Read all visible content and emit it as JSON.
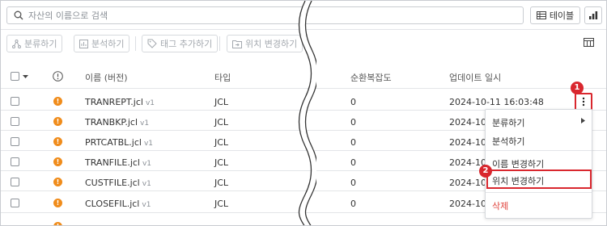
{
  "search": {
    "placeholder": "자산의 이름으로 검색"
  },
  "view": {
    "table_label": "테이블"
  },
  "toolbar": {
    "classify": "분류하기",
    "analyze": "분석하기",
    "add_tag": "태그 추가하기",
    "move": "위치 변경하기"
  },
  "table": {
    "headers": {
      "name": "이름 (버전)",
      "type": "타입",
      "complexity": "순환복잡도",
      "updated": "업데이트 일시"
    },
    "rows": [
      {
        "name": "TRANREPT.jcl",
        "version": "v1",
        "type": "JCL",
        "complexity": "0",
        "updated": "2024-10-11 16:03:48"
      },
      {
        "name": "TRANBKP.jcl",
        "version": "v1",
        "type": "JCL",
        "complexity": "0",
        "updated": "2024-10-1"
      },
      {
        "name": "PRTCATBL.jcl",
        "version": "v1",
        "type": "JCL",
        "complexity": "0",
        "updated": "2024-10-1"
      },
      {
        "name": "TRANFILE.jcl",
        "version": "v1",
        "type": "JCL",
        "complexity": "0",
        "updated": "2024-10-1"
      },
      {
        "name": "CUSTFILE.jcl",
        "version": "v1",
        "type": "JCL",
        "complexity": "0",
        "updated": "2024-10-1"
      },
      {
        "name": "CLOSEFIL.jcl",
        "version": "v1",
        "type": "JCL",
        "complexity": "0",
        "updated": "2024-10-1"
      }
    ]
  },
  "context_menu": {
    "items": [
      "분류하기",
      "분석하기",
      "이름 변경하기",
      "위치 변경하기",
      "삭제"
    ]
  },
  "callouts": [
    "1",
    "2"
  ],
  "colors": {
    "accent_red": "#d9272e",
    "warning": "#f08c1b",
    "danger_text": "#e0433c"
  }
}
